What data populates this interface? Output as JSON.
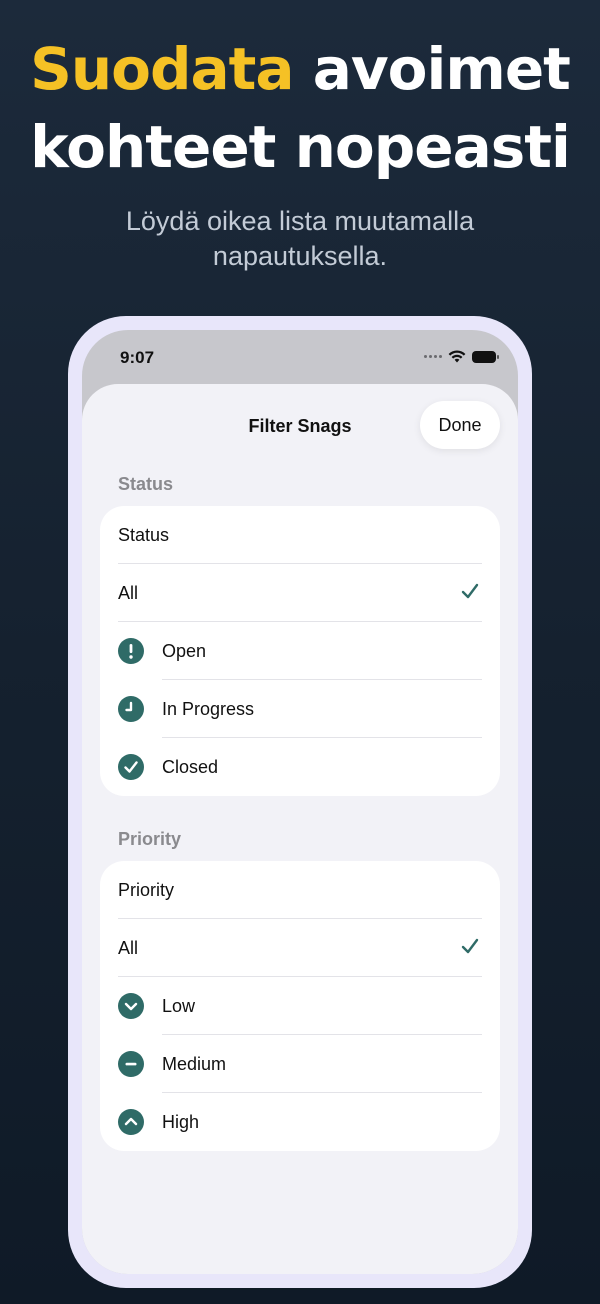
{
  "headline": {
    "accent": "Suodata",
    "rest_line1": " avoimet",
    "line2": "kohteet nopeasti"
  },
  "subtitle": "Löydä oikea lista muutamalla napautuksella.",
  "status_bar": {
    "time": "9:07"
  },
  "sheet": {
    "title": "Filter Snags",
    "done_label": "Done"
  },
  "status_section": {
    "header": "Status",
    "picker_label": "Status",
    "options": [
      {
        "label": "All",
        "selected": true
      },
      {
        "label": "Open",
        "icon": "exclamation-icon"
      },
      {
        "label": "In Progress",
        "icon": "clock-icon"
      },
      {
        "label": "Closed",
        "icon": "checkmark-circle-icon"
      }
    ]
  },
  "priority_section": {
    "header": "Priority",
    "picker_label": "Priority",
    "options": [
      {
        "label": "All",
        "selected": true
      },
      {
        "label": "Low",
        "icon": "chevron-down-circle-icon"
      },
      {
        "label": "Medium",
        "icon": "minus-circle-icon"
      },
      {
        "label": "High",
        "icon": "chevron-up-circle-icon"
      }
    ]
  },
  "colors": {
    "accent_yellow": "#f5c125",
    "icon_teal": "#2f6b67",
    "background_navy": "#1a2636"
  }
}
